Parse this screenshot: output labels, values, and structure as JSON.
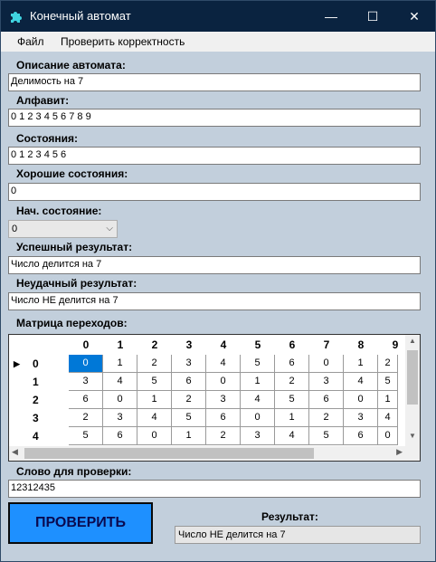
{
  "window": {
    "title": "Конечный автомат",
    "minimize": "—",
    "maximize": "☐",
    "close": "✕"
  },
  "menu": {
    "file": "Файл",
    "check_correctness": "Проверить корректность"
  },
  "form": {
    "description_label": "Описание автомата:",
    "description_value": "Делимость на 7",
    "alphabet_label": "Алфавит:",
    "alphabet_value": "0 1 2 3 4 5 6 7 8 9",
    "states_label": "Состояния:",
    "states_value": "0 1 2 3 4 5 6",
    "good_states_label": "Хорошие состояния:",
    "good_states_value": "0",
    "initial_state_label": "Нач. состояние:",
    "initial_state_value": "0",
    "success_label": "Успешный результат:",
    "success_value": "Число делится на 7",
    "failure_label": "Неудачный результат:",
    "failure_value": "Число НЕ делится на 7",
    "matrix_label": "Матрица переходов:",
    "word_label": "Слово для проверки:",
    "word_value": "12312435",
    "check_button": "ПРОВЕРИТЬ",
    "result_label": "Результат:",
    "result_value": "Число НЕ делится на 7"
  },
  "matrix": {
    "columns": [
      "0",
      "1",
      "2",
      "3",
      "4",
      "5",
      "6",
      "7",
      "8",
      "9"
    ],
    "rows": [
      {
        "state": "0",
        "cells": [
          "0",
          "1",
          "2",
          "3",
          "4",
          "5",
          "6",
          "0",
          "1",
          "2"
        ]
      },
      {
        "state": "1",
        "cells": [
          "3",
          "4",
          "5",
          "6",
          "0",
          "1",
          "2",
          "3",
          "4",
          "5"
        ]
      },
      {
        "state": "2",
        "cells": [
          "6",
          "0",
          "1",
          "2",
          "3",
          "4",
          "5",
          "6",
          "0",
          "1"
        ]
      },
      {
        "state": "3",
        "cells": [
          "2",
          "3",
          "4",
          "5",
          "6",
          "0",
          "1",
          "2",
          "3",
          "4"
        ]
      },
      {
        "state": "4",
        "cells": [
          "5",
          "6",
          "0",
          "1",
          "2",
          "3",
          "4",
          "5",
          "6",
          "0"
        ]
      }
    ],
    "selected_row": 0,
    "selected_col": 0,
    "current_row_marker": "▶"
  },
  "colors": {
    "window_bg": "#c2cfdc",
    "titlebar_bg": "#0a2340",
    "button_bg": "#1e90ff",
    "selection_bg": "#0078d7"
  },
  "icons": {
    "app": "puzzle-icon"
  }
}
